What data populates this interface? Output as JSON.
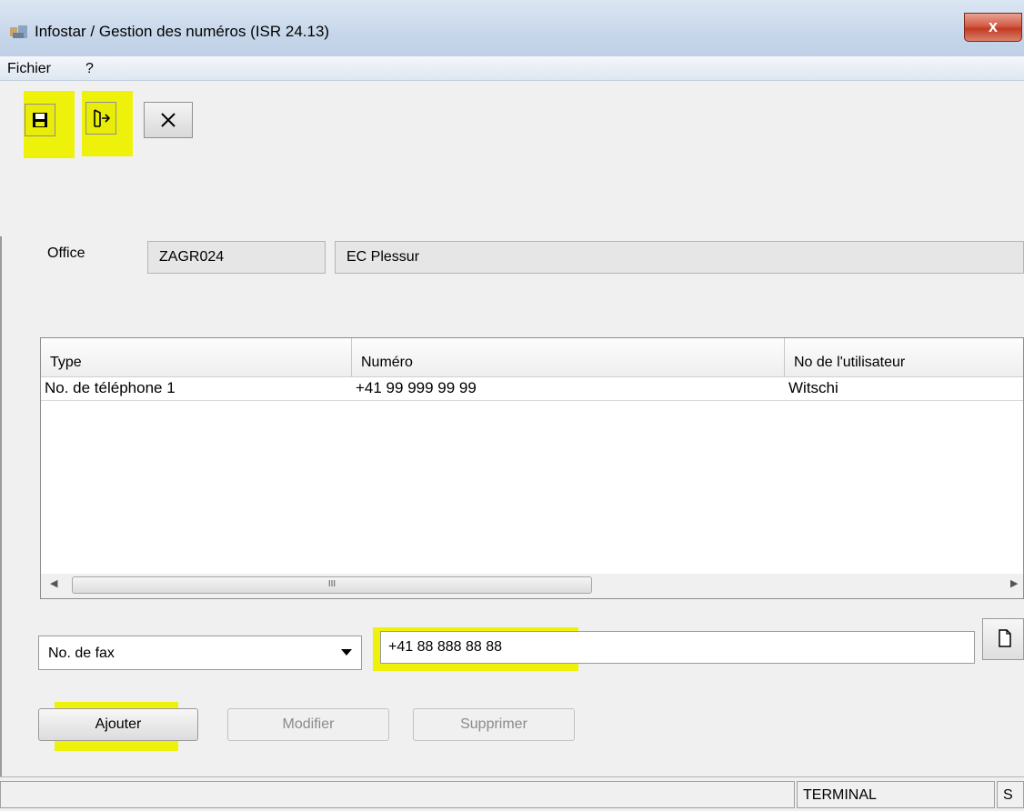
{
  "window": {
    "title": "Infostar / Gestion des numéros (ISR 24.13)",
    "close_label": "x"
  },
  "menu": [
    {
      "label": "Fichier"
    },
    {
      "label": "?"
    }
  ],
  "toolbar": {
    "highlight_color": "#eef20a",
    "buttons": [
      {
        "name": "save",
        "icon": "floppy-disk-icon",
        "highlighted": true
      },
      {
        "name": "exit",
        "icon": "door-exit-icon",
        "highlighted": true
      },
      {
        "name": "cancel",
        "icon": "close-x-icon",
        "highlighted": false
      }
    ]
  },
  "office": {
    "label": "Office",
    "code": "ZAGR024",
    "name": "EC Plessur"
  },
  "table": {
    "columns": [
      "Type",
      "Numéro",
      "No de l'utilisateur"
    ],
    "rows": [
      [
        "No. de téléphone 1",
        "+41 99 999 99 99",
        "Witschi"
      ]
    ],
    "scroll_thumb_label": "III"
  },
  "entry": {
    "type_selected": "No. de fax",
    "number_value": "+41 88 888 88 88"
  },
  "actions": {
    "add_label": "Ajouter",
    "modify_label": "Modifier",
    "delete_label": "Supprimer"
  },
  "status": {
    "terminal": "TERMINAL",
    "last": "S"
  }
}
